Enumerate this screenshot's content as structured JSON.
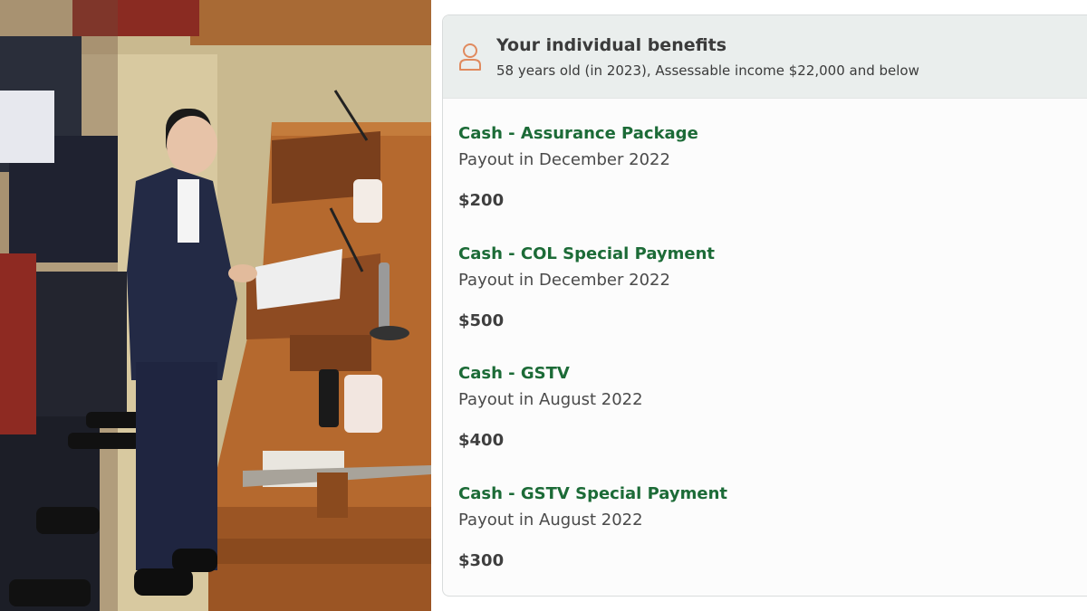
{
  "photo": {
    "subject": "Minister speaking at lectern in Parliament chamber"
  },
  "card": {
    "header": {
      "icon": "person-icon",
      "title": "Your individual benefits",
      "subtitle": "58 years old (in 2023), Assessable income $22,000 and below"
    },
    "benefits": [
      {
        "name": "Cash - Assurance Package",
        "payout": "Payout in December 2022",
        "amount": "$200"
      },
      {
        "name": "Cash - COL Special Payment",
        "payout": "Payout in December 2022",
        "amount": "$500"
      },
      {
        "name": "Cash - GSTV",
        "payout": "Payout in August 2022",
        "amount": "$400"
      },
      {
        "name": "Cash - GSTV Special Payment",
        "payout": "Payout in August 2022",
        "amount": "$300"
      }
    ]
  },
  "colors": {
    "benefit_name": "#1c6b37",
    "header_bg": "#eaeeed",
    "icon_accent": "#e08a5e"
  }
}
